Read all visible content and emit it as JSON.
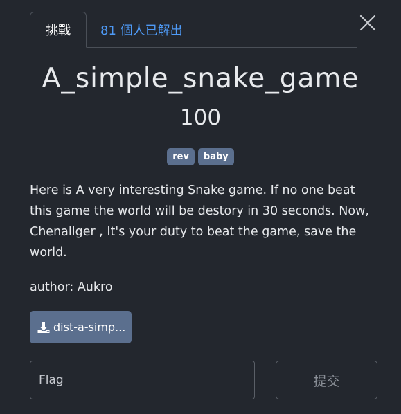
{
  "tabs": {
    "challenge_label": "挑戰",
    "solves_label": "81 個人已解出"
  },
  "challenge": {
    "title": "A_simple_snake_game",
    "points": "100",
    "tags": [
      "rev",
      "baby"
    ],
    "description": "Here is A very interesting Snake game. If no one beat this game the world will be destory in 30 seconds. Now, Chenallger , It's your duty to beat the game, save the world.",
    "author": "author: Aukro"
  },
  "files": [
    {
      "label": "dist-a-simp..."
    }
  ],
  "submission": {
    "flag_placeholder": "Flag",
    "submit_label": "提交"
  },
  "icons": {
    "close": "close-icon",
    "download": "download-icon"
  },
  "colors": {
    "background": "#23272e",
    "accent": "#4e9af6",
    "tag_bg": "#5b6f8e"
  }
}
